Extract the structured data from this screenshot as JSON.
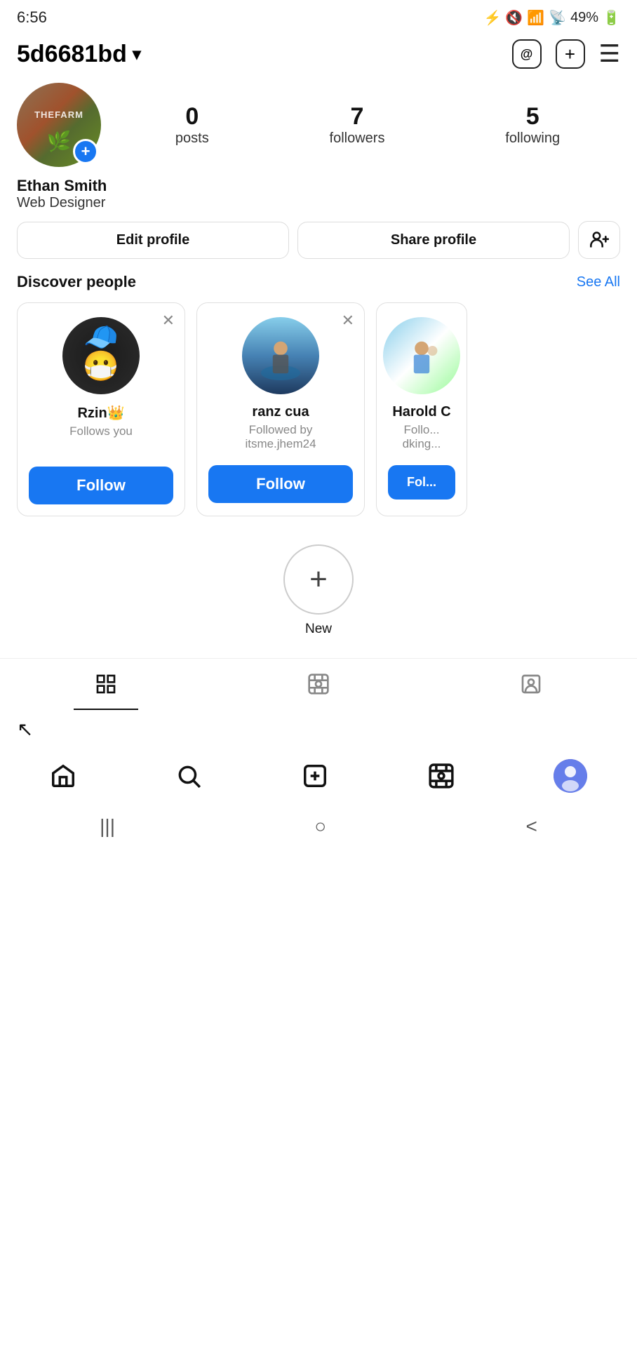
{
  "statusBar": {
    "time": "6:56",
    "battery": "49%",
    "icons": [
      "camera",
      "bluetooth-off",
      "mute",
      "wifi",
      "signal",
      "battery"
    ]
  },
  "header": {
    "username": "5d6681bd",
    "dropdown_icon": "▾",
    "threads_label": "@",
    "add_label": "+",
    "menu_label": "☰"
  },
  "profile": {
    "name": "Ethan Smith",
    "bio": "Web Designer",
    "stats": {
      "posts": {
        "value": "0",
        "label": "posts"
      },
      "followers": {
        "value": "7",
        "label": "followers"
      },
      "following": {
        "value": "5",
        "label": "following"
      }
    },
    "add_badge": "+"
  },
  "actions": {
    "edit_label": "Edit profile",
    "share_label": "Share profile",
    "add_person_icon": "👤+"
  },
  "discover": {
    "title": "Discover people",
    "see_all": "See All",
    "cards": [
      {
        "name": "Rzin👑",
        "sub": "Follows you",
        "follow_label": "Follow"
      },
      {
        "name": "ranz cua",
        "sub": "Followed by\nitsme.jhem24",
        "follow_label": "Follow"
      },
      {
        "name": "Harold C",
        "sub": "Follo...\ndking...",
        "follow_label": "Fol..."
      }
    ]
  },
  "stories": {
    "new_label": "New",
    "new_icon": "+"
  },
  "content_tabs": {
    "grid_icon": "⊞",
    "reels_icon": "▶",
    "tagged_icon": "👤"
  },
  "nav": {
    "home_icon": "⌂",
    "search_icon": "🔍",
    "add_icon": "⊕",
    "reels_icon": "▶",
    "cursor_label": "↖"
  },
  "system_nav": {
    "menu_icon": "|||",
    "home_icon": "○",
    "back_icon": "<"
  }
}
